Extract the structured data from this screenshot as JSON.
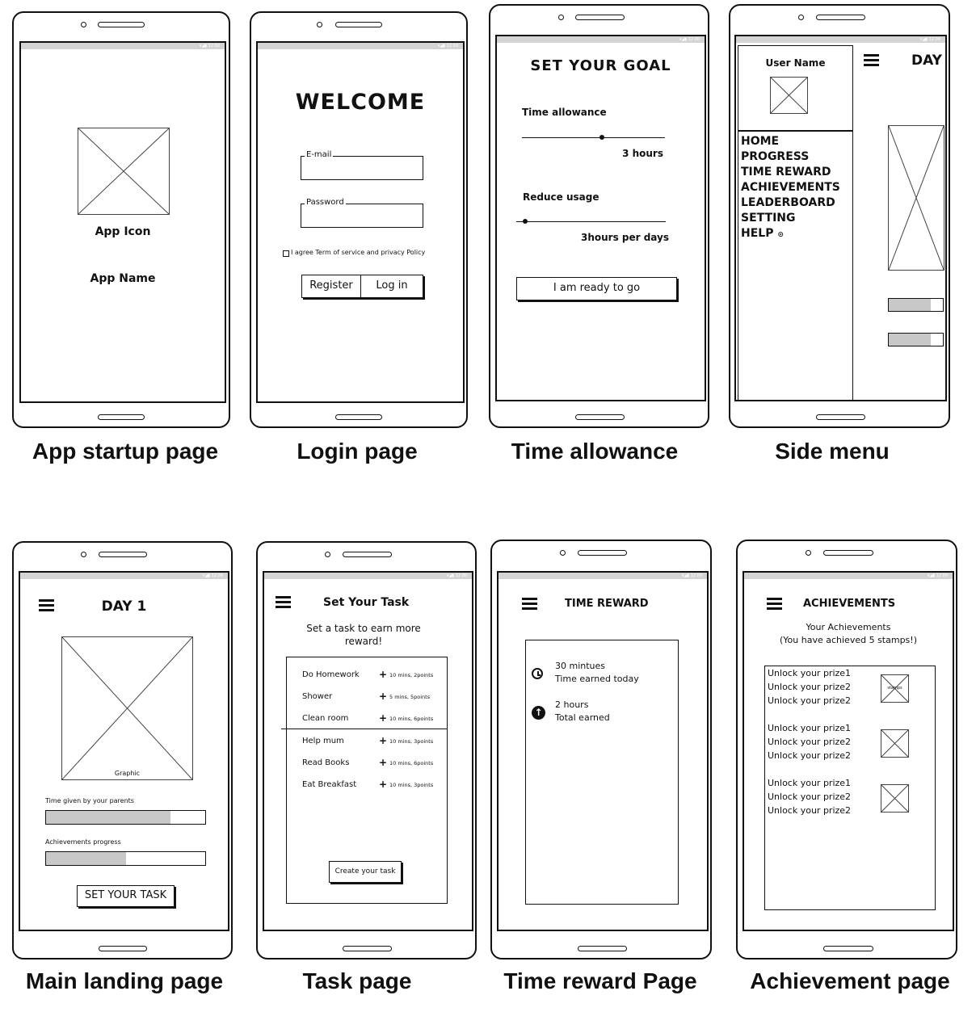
{
  "captions": {
    "startup": "App startup page",
    "login": "Login page",
    "time_allowance": "Time allowance",
    "side_menu": "Side menu",
    "main_landing": "Main landing page",
    "task": "Task page",
    "time_reward": "Time reward Page",
    "achievement": "Achievement page"
  },
  "startup": {
    "icon_label": "App Icon",
    "name_label": "App Name"
  },
  "login": {
    "title": "WELCOME",
    "email_label": "E-mail",
    "password_label": "Password",
    "agree_text": "I agree Term of service and privacy Policy",
    "register": "Register",
    "login": "Log in"
  },
  "goal": {
    "title": "SET YOUR GOAL",
    "time_label": "Time allowance",
    "time_value": "3 hours",
    "time_level": 0.56,
    "reduce_label": "Reduce usage",
    "reduce_value": "3hours per days",
    "reduce_level": 0.06,
    "button": "I am ready to go"
  },
  "side": {
    "user": "User Name",
    "day": "DAY",
    "menu": [
      "HOME",
      "PROGRESS",
      "TIME REWARD",
      "ACHIEVEMENTS",
      "LEADERBOARD",
      "SETTING",
      "HELP"
    ],
    "bar1_level": 0.78,
    "bar2_level": 0.78
  },
  "main": {
    "title": "DAY 1",
    "graphic": "Graphic",
    "parents_label": "Time given by your parents",
    "parents_level": 0.78,
    "achievements_label": "Achievements progress",
    "achievements_level": 0.5,
    "button": "SET YOUR TASK"
  },
  "task": {
    "title": "Set Your Task",
    "subtitle": "Set a task to earn more reward!",
    "items": [
      {
        "name": "Do Homework",
        "detail": "10 mins, 2points"
      },
      {
        "name": "Shower",
        "detail": "5 mins, 5points"
      },
      {
        "name": "Clean room",
        "detail": "10 mins, 6points"
      },
      {
        "name": "Help mum",
        "detail": "10 mins, 3points"
      },
      {
        "name": "Read Books",
        "detail": "10 mins, 6points"
      },
      {
        "name": "Eat Breakfast",
        "detail": "10 mins, 3points"
      }
    ],
    "button": "Create your task"
  },
  "reward": {
    "title": "TIME REWARD",
    "row1_value": "30 mintues",
    "row1_label": "Time earned today",
    "row2_value": "2 hours",
    "row2_label": "Total earned"
  },
  "ach": {
    "title": "ACHIEVEMENTS",
    "subtitle1": "Your Achievements",
    "subtitle2": "(You have achieved 5 stamps!)",
    "groups": [
      {
        "lines": [
          "Unlock your prize1",
          "Unlock your prize2",
          "Unlock your prize2"
        ],
        "stamp": "stamps"
      },
      {
        "lines": [
          "Unlock your prize1",
          "Unlock your prize2",
          "Unlock your prize2"
        ]
      },
      {
        "lines": [
          "Unlock your prize1",
          "Unlock your prize2",
          "Unlock your prize2"
        ]
      }
    ]
  }
}
